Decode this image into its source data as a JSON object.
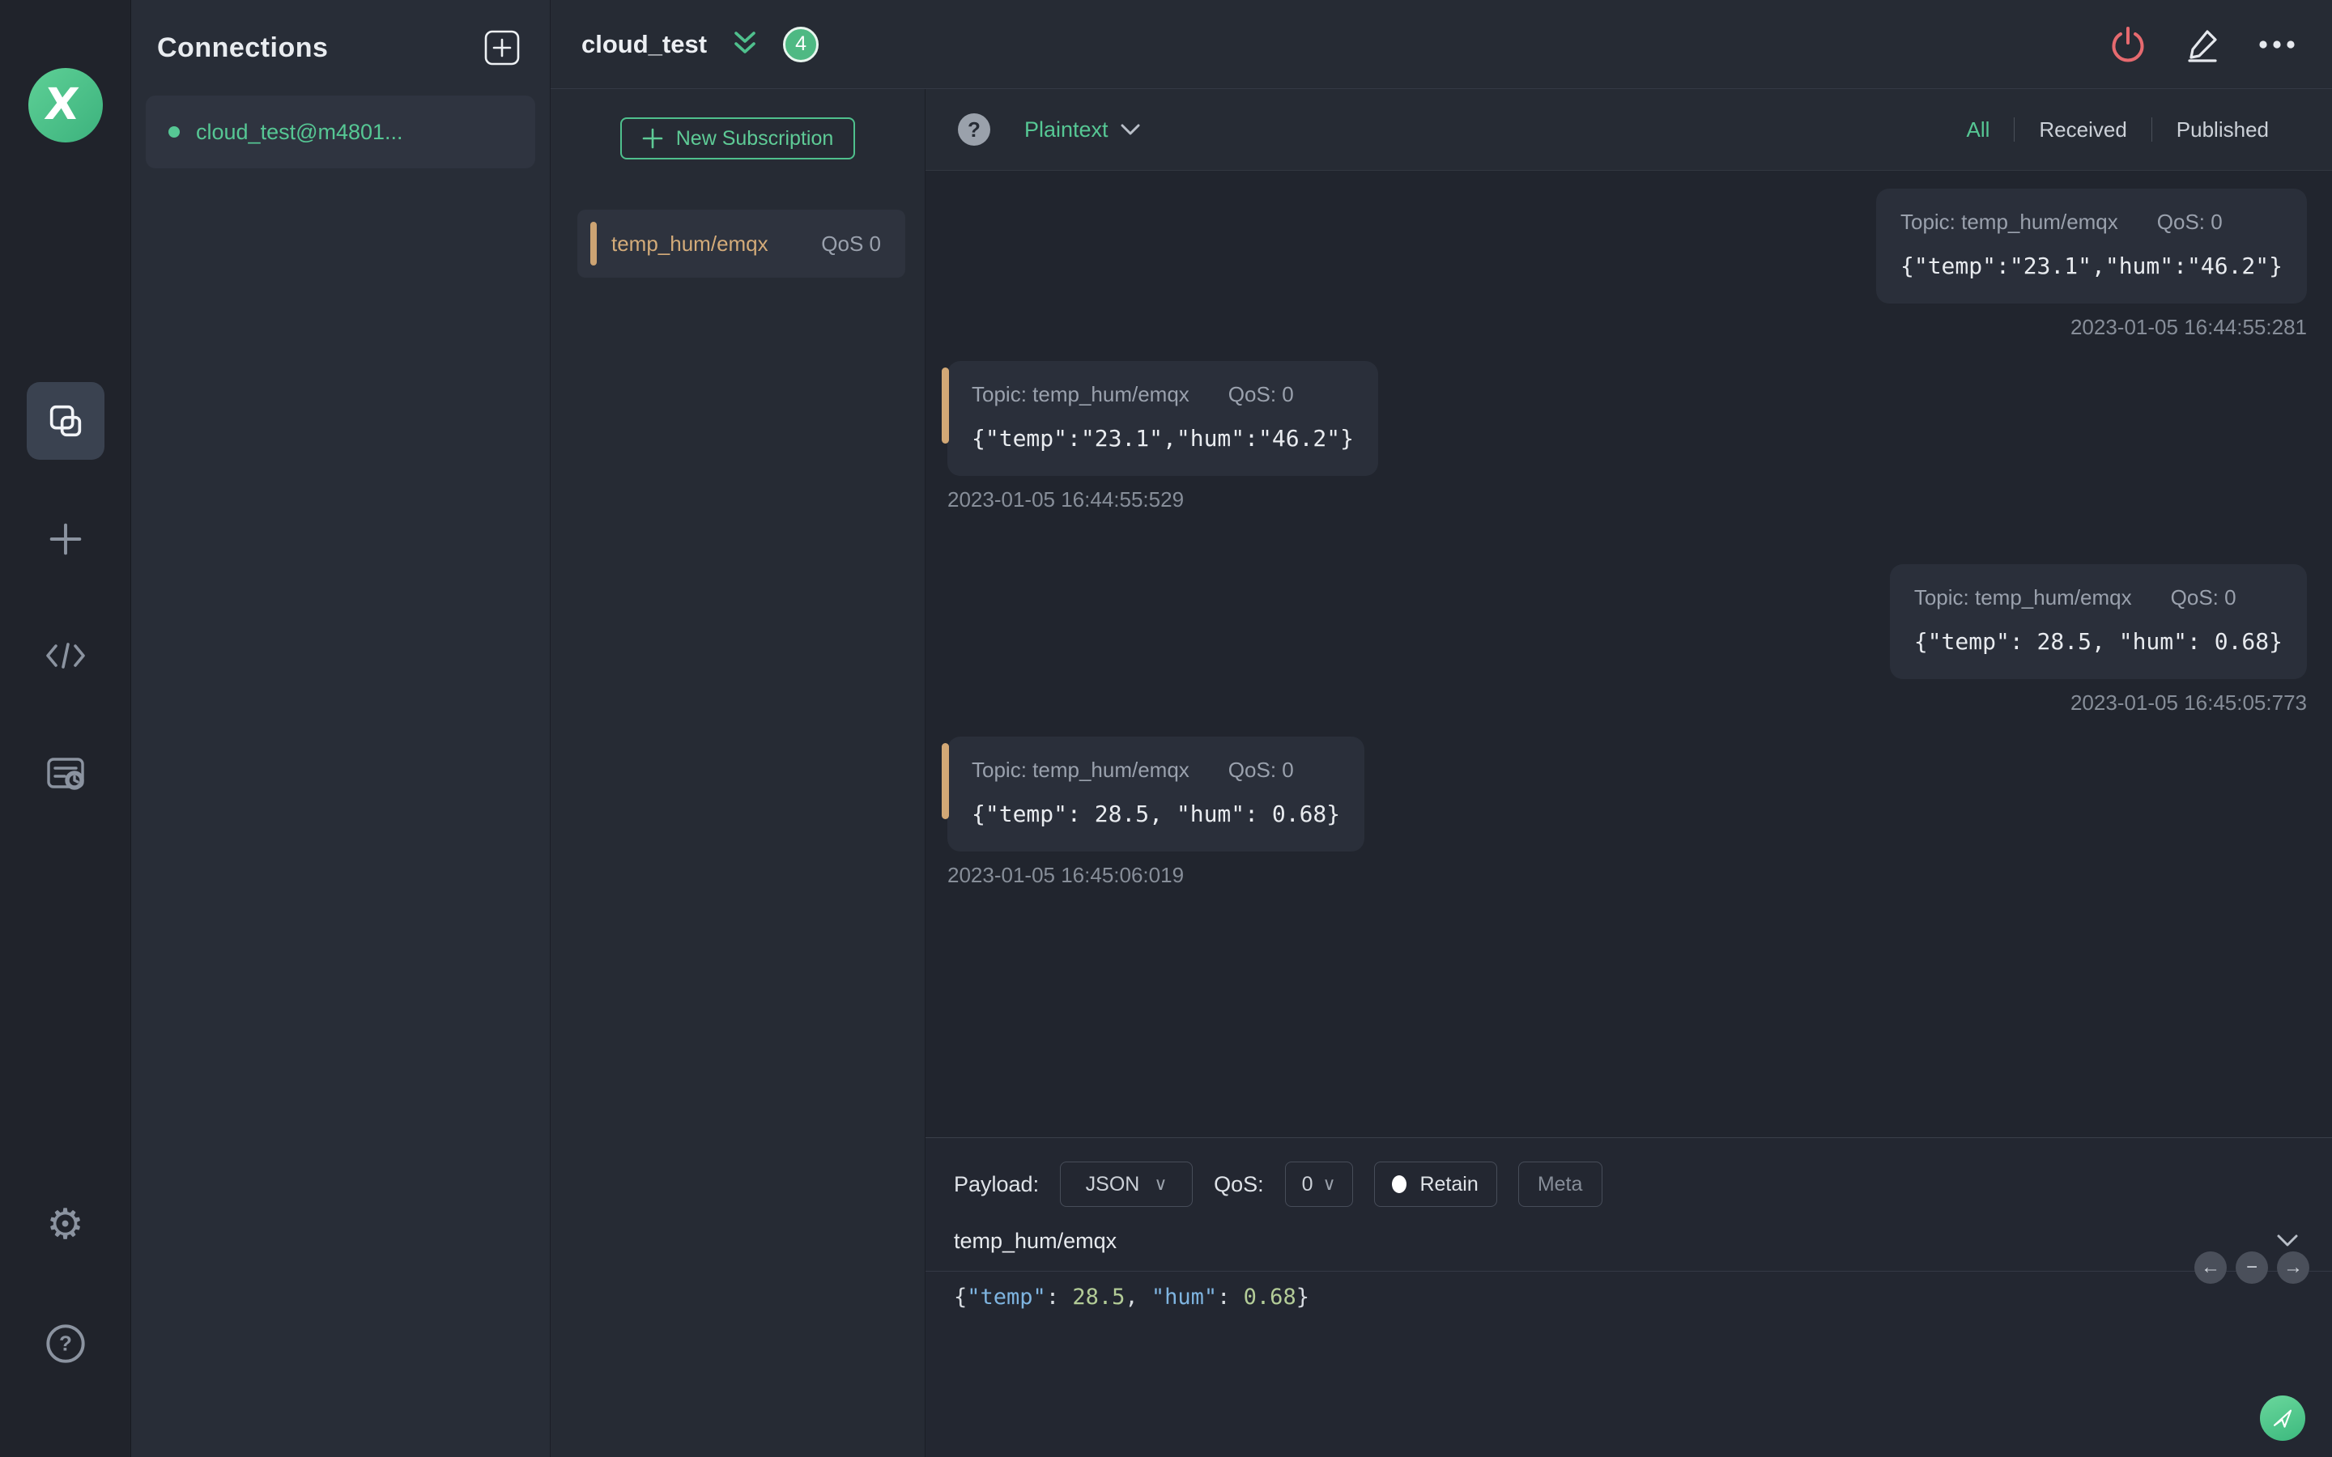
{
  "colors": {
    "accent_green": "#56c794",
    "badge_green": "#4eb983",
    "topic_tan": "#d3ab79",
    "power_red": "#e66a6f",
    "bubble_bg": "#2a2f3a",
    "panel_bg": "#282d37"
  },
  "rail": {
    "logo": "mqttx-logo",
    "items": [
      {
        "icon": "connections-icon",
        "active": true
      },
      {
        "icon": "new-connection-plus-icon"
      },
      {
        "icon": "script-code-icon"
      },
      {
        "icon": "log-icon"
      },
      {
        "icon": "settings-gear-icon"
      },
      {
        "icon": "help-icon"
      }
    ],
    "gear_glyph": "⚙"
  },
  "connections": {
    "title": "Connections",
    "items": [
      {
        "name": "cloud_test@m4801...",
        "status": "connected"
      }
    ]
  },
  "header": {
    "title": "cloud_test",
    "badge_count": "4",
    "actions": [
      "disconnect",
      "edit",
      "more"
    ]
  },
  "subscriptions": {
    "new_button_label": "New Subscription",
    "items": [
      {
        "topic": "temp_hum/emqx",
        "qos": "QoS 0"
      }
    ]
  },
  "filter_bar": {
    "help_glyph": "?",
    "format_label": "Plaintext",
    "tabs": [
      {
        "label": "All",
        "active": true
      },
      {
        "label": "Received",
        "active": false
      },
      {
        "label": "Published",
        "active": false
      }
    ]
  },
  "messages": [
    {
      "side": "right",
      "topic": "Topic: temp_hum/emqx",
      "qos": "QoS: 0",
      "payload": "{\"temp\":\"23.1\",\"hum\":\"46.2\"}",
      "time": "2023-01-05 16:44:55:281"
    },
    {
      "side": "left",
      "topic": "Topic: temp_hum/emqx",
      "qos": "QoS: 0",
      "payload": "{\"temp\":\"23.1\",\"hum\":\"46.2\"}",
      "time": "2023-01-05 16:44:55:529"
    },
    {
      "side": "right",
      "topic": "Topic: temp_hum/emqx",
      "qos": "QoS: 0",
      "payload": "{\"temp\": 28.5, \"hum\": 0.68}",
      "time": "2023-01-05 16:45:05:773"
    },
    {
      "side": "left",
      "topic": "Topic: temp_hum/emqx",
      "qos": "QoS: 0",
      "payload": "{\"temp\": 28.5, \"hum\": 0.68}",
      "time": "2023-01-05 16:45:06:019"
    }
  ],
  "publish": {
    "payload_label": "Payload:",
    "payload_format": "JSON",
    "qos_label": "QoS:",
    "qos_value": "0",
    "retain_label": "Retain",
    "meta_label": "Meta",
    "topic_value": "temp_hum/emqx",
    "editor_tokens": [
      "{",
      "\"temp\"",
      ": ",
      "28.5",
      ", ",
      "\"hum\"",
      ": ",
      "0.68",
      "}"
    ],
    "pager_glyphs": {
      "prev": "←",
      "remove": "−",
      "next": "→"
    }
  }
}
